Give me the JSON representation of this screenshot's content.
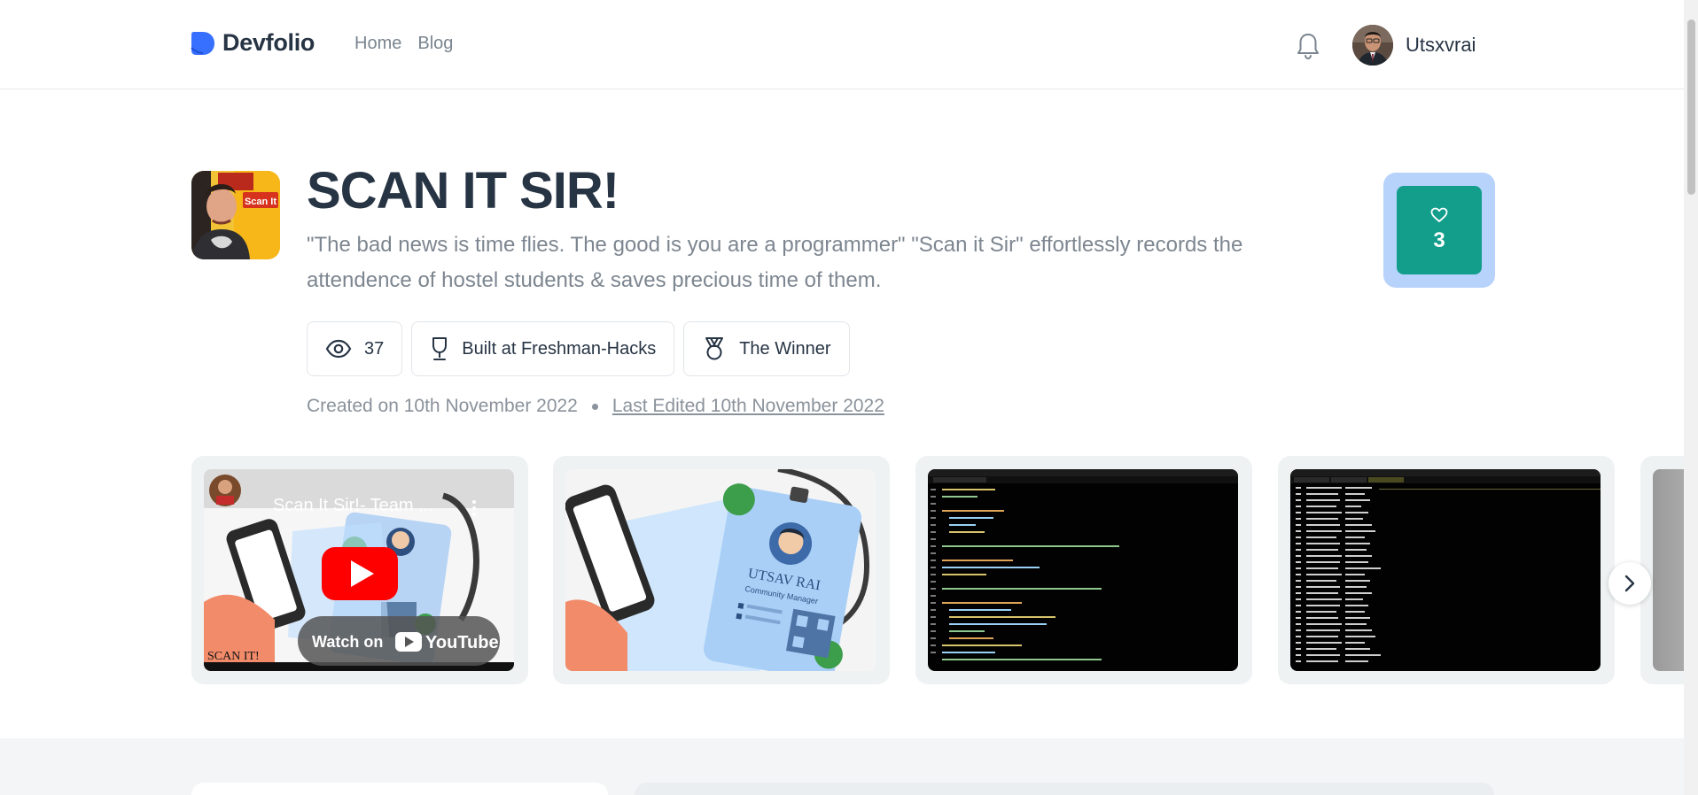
{
  "header": {
    "brand": "Devfolio",
    "nav": [
      {
        "label": "Home"
      },
      {
        "label": "Blog"
      }
    ],
    "user_name": "Utsxvrai"
  },
  "project": {
    "title": "SCAN IT SIR!",
    "description": "\"The bad news is time flies. The good is you are a programmer\" \"Scan it Sir\" effortlessly records the attendence of hostel students & saves precious time of them.",
    "views": "37",
    "built_at": "Built at Freshman-Hacks",
    "award": "The Winner",
    "created": "Created on 10th November 2022",
    "last_edited": "Last Edited 10th November 2022",
    "likes": "3",
    "logo_text": "Scan It"
  },
  "gallery": {
    "video": {
      "title": "Scan It Sir!- Team ...",
      "watch_label": "Watch on",
      "yt_label": "YouTube",
      "caption": "SCAN IT!"
    },
    "id_card_name": "UTSAV RAI",
    "id_card_role": "Community Manager"
  },
  "colors": {
    "accent": "#139e8b",
    "like_ring": "#b7d2fb",
    "brand": "#3770ff",
    "youtube_red": "#ff0000"
  },
  "icons": [
    "bell-icon",
    "eye-icon",
    "trophy-icon",
    "medal-icon",
    "heart-icon",
    "chevron-right-icon",
    "play-icon"
  ]
}
